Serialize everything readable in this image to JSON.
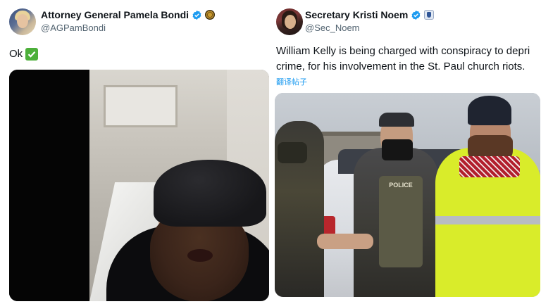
{
  "left_post": {
    "display_name": "Attorney General Pamela Bondi",
    "handle": "@AGPamBondi",
    "text": "Ok",
    "emoji": "check-mark-button",
    "verified_icon": "verified-badge-icon",
    "affiliation_icon": "doj-seal-icon",
    "media_type": "video-still"
  },
  "right_post": {
    "display_name": "Secretary Kristi Noem",
    "handle": "@Sec_Noem",
    "text_line1": "William Kelly is being charged with conspiracy to depri",
    "text_line2": "crime, for his involvement in the St. Paul church riots.",
    "translate_label": "翻译帖子",
    "vest_text": "POLICE",
    "verified_icon": "verified-badge-icon",
    "affiliation_icon": "dhs-seal-icon",
    "media_type": "photo"
  },
  "colors": {
    "verified_blue": "#1d9bf0",
    "link_blue": "#1d9bf0",
    "handle_gray": "#536471",
    "text_dark": "#0f1419",
    "check_green": "#4caf3a"
  }
}
